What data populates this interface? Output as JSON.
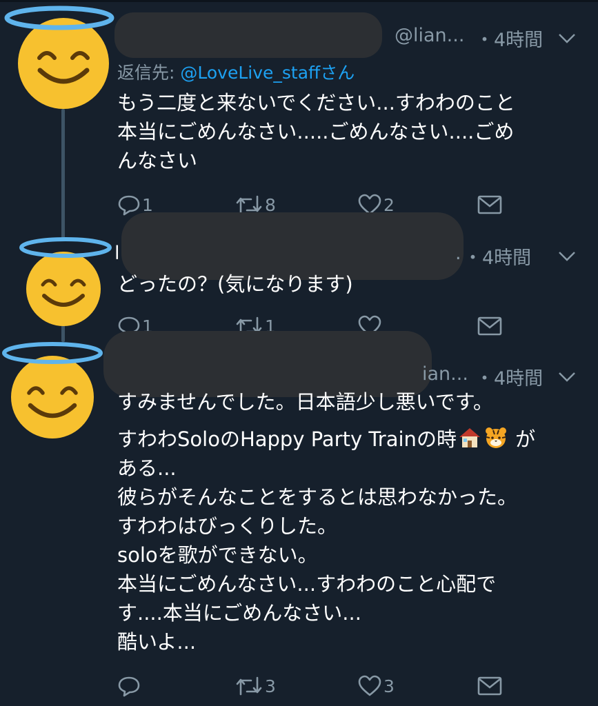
{
  "tweets": [
    {
      "handle": "@lian...",
      "time": "・4時間",
      "reply_prefix": "返信先: ",
      "reply_to": "@LoveLive_staffさん",
      "lines": [
        "もう二度と来ないでください...すわわのこと",
        "本当にごめんなさい.....ごめんなさい....ごめ",
        "んなさい"
      ],
      "counts": {
        "reply": "1",
        "retweet": "8",
        "like": "2"
      }
    },
    {
      "handle_fragment": "l",
      "trail": ".",
      "time": "・4時間",
      "lines": [
        "どったの？(気になります)"
      ],
      "counts": {
        "reply": "1",
        "retweet": "1",
        "like": ""
      }
    },
    {
      "handle": "ian...",
      "time": "・4時間",
      "paragraphs": [
        [
          "すみませんでした。日本語少し悪いです。"
        ],
        [
          "すわわSoloのHappy Party Trainの時",
          "ある...",
          "彼らがそんなことをするとは思わなかった。",
          "すわわはびっくりした。",
          "soloを歌ができない。",
          "本当にごめんなさい...すわわのこと心配で",
          "す....本当にごめんなさい...",
          "酷いよ..."
        ]
      ],
      "inline_emoji_after": "が",
      "inline_emoji": [
        "house-icon",
        "tiger-face-icon"
      ],
      "counts": {
        "reply": "",
        "retweet": "3",
        "like": "3"
      }
    }
  ],
  "avatar_emoji": "smiling-face-with-halo",
  "colors": {
    "background": "#16202c",
    "muted": "#8899a6",
    "link": "#1da1f2",
    "redaction": "#2c2f33",
    "thread_line": "#3d5466",
    "emoji": "#f7c12f"
  }
}
